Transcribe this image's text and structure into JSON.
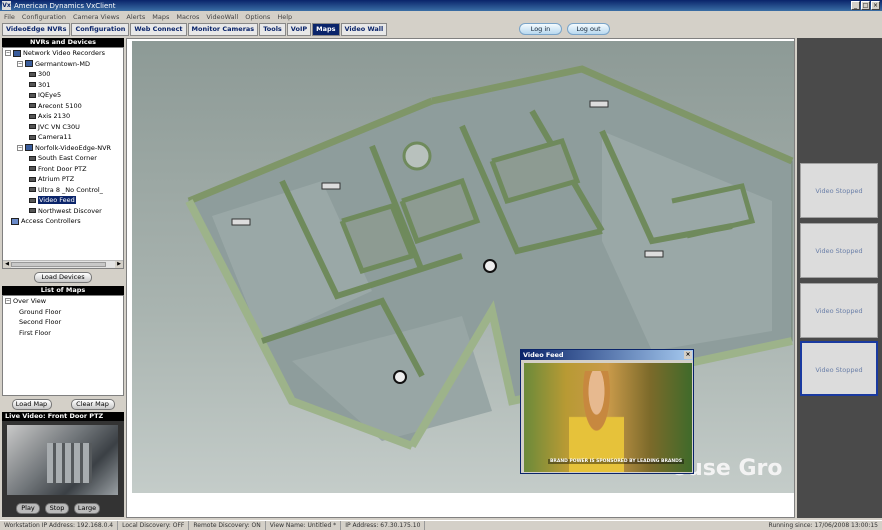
{
  "window": {
    "title": "American Dynamics VxClient",
    "app_icon": "Vx"
  },
  "menu": [
    "File",
    "Configuration",
    "Camera Views",
    "Alerts",
    "Maps",
    "Macros",
    "VideoWall",
    "Options",
    "Help"
  ],
  "tabs": [
    {
      "label": "VideoEdge NVRs",
      "active": false
    },
    {
      "label": "Configuration",
      "active": false
    },
    {
      "label": "Web Connect",
      "active": false
    },
    {
      "label": "Monitor Cameras",
      "active": false
    },
    {
      "label": "Tools",
      "active": false
    },
    {
      "label": "VoIP",
      "active": false
    },
    {
      "label": "Maps",
      "active": true
    },
    {
      "label": "Video Wall",
      "active": false
    }
  ],
  "session": {
    "login_label": "Log in",
    "logout_label": "Log out"
  },
  "nvr_panel": {
    "header": "NVRs and Devices",
    "root": "Network Video Recorders",
    "group1": "Germantown-MD",
    "group1_cams": [
      "300",
      "301",
      "IQEye5",
      "Arecont 5100",
      "Axis 2130",
      "JVC VN C30U",
      "Camera11"
    ],
    "group2": "Norfolk-VideoEdge-NVR",
    "group2_cams": [
      "South East Corner",
      "Front Door PTZ",
      "Atrium PTZ",
      "Ultra 8 _No Control_",
      "Video Feed",
      "Northwest Discover"
    ],
    "selected": "Video Feed",
    "access": "Access Controllers",
    "load_button": "Load Devices"
  },
  "maps_panel": {
    "header": "List of Maps",
    "root": "Over View",
    "items": [
      "Ground Floor",
      "Second Floor",
      "First Floor"
    ],
    "load_button": "Load Map",
    "clear_button": "Clear Map"
  },
  "live_video": {
    "header": "Live Video: Front Door PTZ",
    "play": "Play",
    "stop": "Stop",
    "large": "Large"
  },
  "map": {
    "brand_text": "ouse Gro"
  },
  "popup": {
    "title": "Video Feed",
    "caption": "BRAND POWER IS SPONSORED BY LEADING BRANDS"
  },
  "right_tiles": [
    "Video Stopped",
    "Video Stopped",
    "Video Stopped",
    "Video Stopped"
  ],
  "status": {
    "workstation": "Workstation IP Address: 192.168.0.4",
    "local": "Local Discovery: OFF",
    "remote": "Remote Discovery: ON",
    "view": "View Name: Untitled *",
    "ip": "IP Address: 67.30.175.10",
    "running": "Running since: 17/06/2008 13:00:15"
  },
  "colors": {
    "active_tab": "#0a246a",
    "map_wall": "#7f9668",
    "map_floor": "#8e9d9c",
    "tile_text": "#6a7fa8"
  }
}
